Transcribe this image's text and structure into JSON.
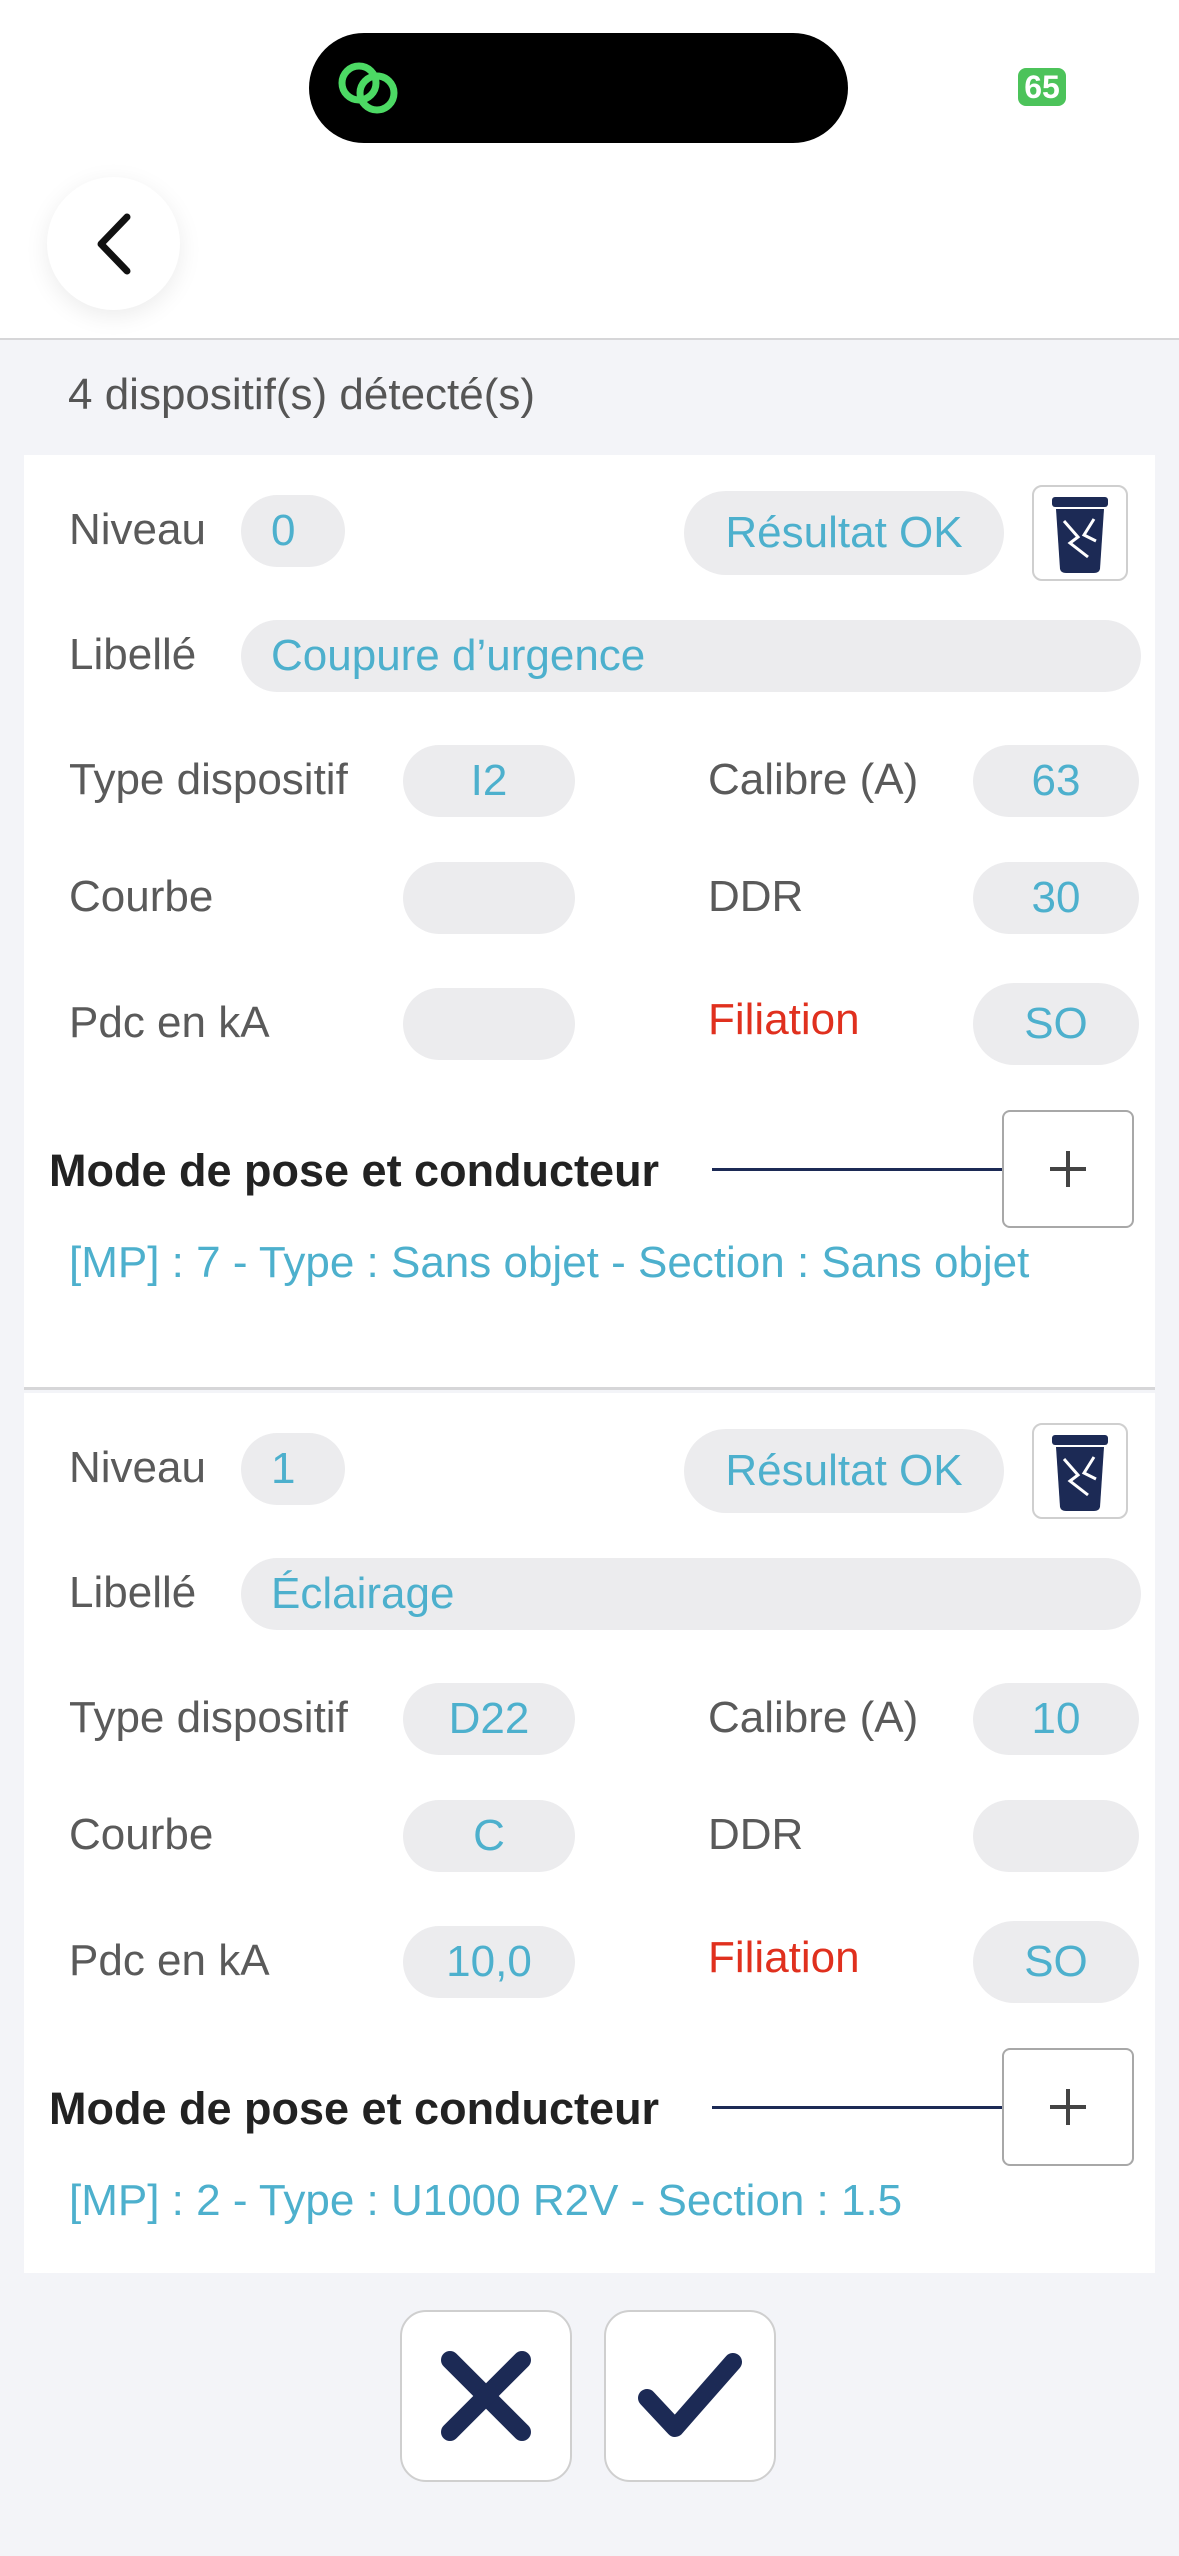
{
  "status_bar": {
    "battery": "65"
  },
  "header": {
    "back_icon": "chevron-left-icon"
  },
  "summary": "4 dispositif(s) détecté(s)",
  "devices": [
    {
      "niveau_label": "Niveau",
      "niveau": "0",
      "resultat": "Résultat OK",
      "libelle_label": "Libellé",
      "libelle": "Coupure d’urgence",
      "type_label": "Type dispositif",
      "type": "I2",
      "calibre_label": "Calibre (A)",
      "calibre": "63",
      "courbe_label": "Courbe",
      "courbe": "",
      "ddr_label": "DDR",
      "ddr": "30",
      "pdc_label": "Pdc en kA",
      "pdc": "",
      "filiation_label": "Filiation",
      "filiation": "SO",
      "mode_title": "Mode de pose et conducteur",
      "mode_text": "[MP] : 7 - Type : Sans objet - Section : Sans objet"
    },
    {
      "niveau_label": "Niveau",
      "niveau": "1",
      "resultat": "Résultat OK",
      "libelle_label": "Libellé",
      "libelle": "Éclairage",
      "type_label": "Type dispositif",
      "type": "D22",
      "calibre_label": "Calibre (A)",
      "calibre": "10",
      "courbe_label": "Courbe",
      "courbe": "C",
      "ddr_label": "DDR",
      "ddr": "",
      "pdc_label": "Pdc en kA",
      "pdc": "10,0",
      "filiation_label": "Filiation",
      "filiation": "SO",
      "mode_title": "Mode de pose et conducteur",
      "mode_text": "[MP] : 2 - Type : U1000 R2V - Section : 1.5"
    }
  ],
  "colors": {
    "accent": "#4db0cd",
    "danger": "#e0301e",
    "navy": "#1c2a55"
  }
}
